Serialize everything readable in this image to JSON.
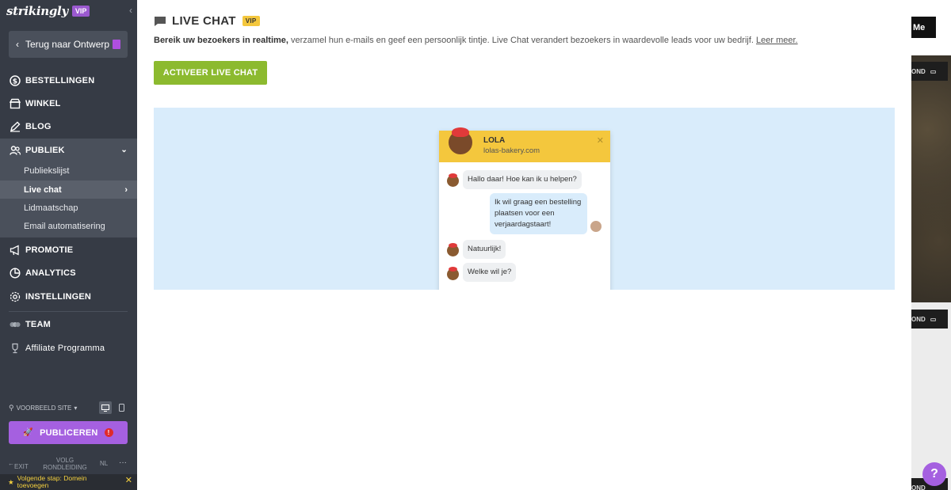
{
  "sidebar": {
    "logo": "strikingly",
    "vip": "VIP",
    "back_label": "Terug naar Ontwerp",
    "nav": {
      "orders": "BESTELLINGEN",
      "store": "WINKEL",
      "blog": "BLOG",
      "audience": "PUBLIEK",
      "promotion": "PROMOTIE",
      "analytics": "ANALYTICS",
      "settings": "INSTELLINGEN",
      "team": "TEAM",
      "affiliate": "Affiliate Programma"
    },
    "submenu": [
      "Publiekslijst",
      "Live chat",
      "Lidmaatschap",
      "Email automatisering"
    ],
    "preview_label": "VOORBEELD SITE",
    "publish_label": "PUBLICEREN",
    "bottom": {
      "exit": "EXIT",
      "tour": "VOLG RONDLEIDING",
      "lang": "NL",
      "more": "···"
    },
    "next_step": "Volgende stap: Domein toevoegen"
  },
  "panel": {
    "title": "LIVE CHAT",
    "vip": "VIP",
    "desc_bold": "Bereik uw bezoekers in realtime,",
    "desc_rest": " verzamel hun e-mails en geef een persoonlijk tintje. Live Chat verandert bezoekers in waardevolle leads voor uw bedrijf.",
    "learn_more": "Leer meer.",
    "activate_label": "ACTIVEER LIVE CHAT"
  },
  "chat_preview": {
    "name": "LOLA",
    "site": "lolas-bakery.com",
    "messages": [
      "Hallo daar! Hoe kan ik u helpen?",
      "Ik wil graag een bestelling plaatsen voor een verjaardagstaart!",
      "Natuurlijk!",
      "Welke wil je?"
    ]
  },
  "site": {
    "me_label": "Me",
    "bg_label": "OND",
    "help": "?"
  },
  "colors": {
    "sidebar": "#363b45",
    "accent_purple": "#a560e0",
    "green": "#8cba2f",
    "yellow": "#f4c73d",
    "preview_bg": "#d9ecfb"
  }
}
